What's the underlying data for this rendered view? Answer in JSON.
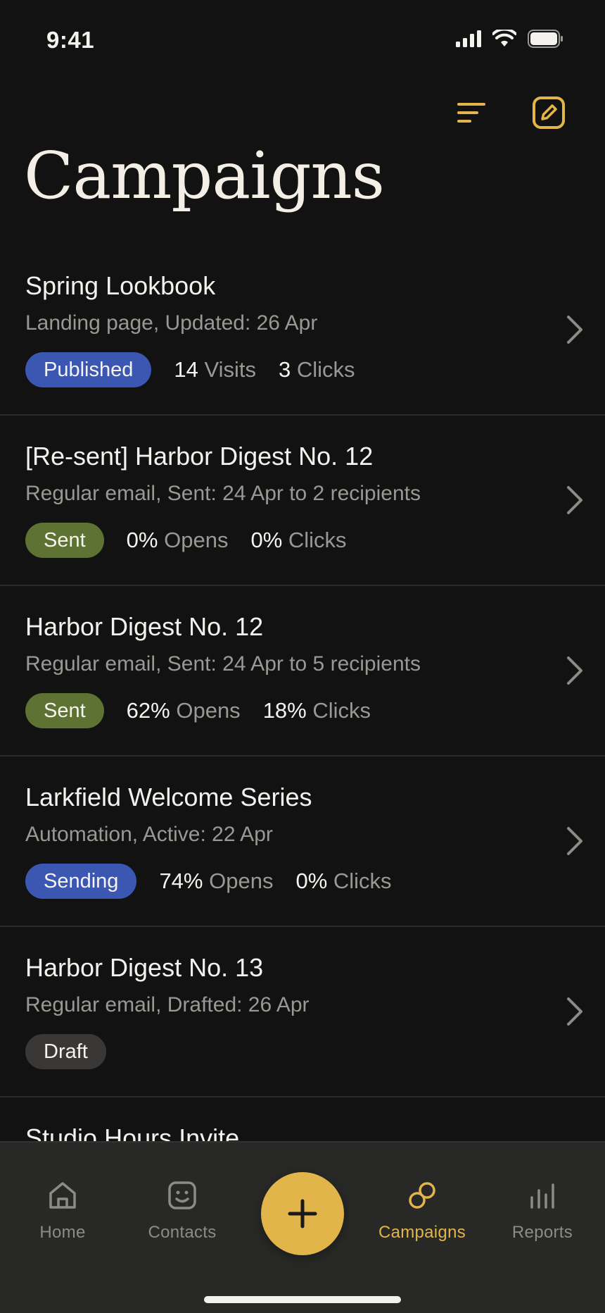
{
  "status": {
    "time": "9:41"
  },
  "header": {
    "title": "Campaigns",
    "sort_icon": "sort-lines-icon",
    "compose_icon": "compose-icon"
  },
  "campaigns": [
    {
      "title": "Spring Lookbook",
      "subtitle": "Landing page, Updated: 26 Apr",
      "badge": "Published",
      "badge_color": "#3c57b2",
      "stat1_value": "14",
      "stat1_label": "Visits",
      "stat2_value": "3",
      "stat2_label": "Clicks"
    },
    {
      "title": "[Re-sent] Harbor Digest No. 12",
      "subtitle": "Regular email, Sent: 24 Apr to 2 recipients",
      "badge": "Sent",
      "badge_color": "#5e7234",
      "stat1_value": "0%",
      "stat1_label": "Opens",
      "stat2_value": "0%",
      "stat2_label": "Clicks"
    },
    {
      "title": "Harbor Digest No. 12",
      "subtitle": "Regular email, Sent: 24 Apr to 5 recipients",
      "badge": "Sent",
      "badge_color": "#5e7234",
      "stat1_value": "62%",
      "stat1_label": "Opens",
      "stat2_value": "18%",
      "stat2_label": "Clicks"
    },
    {
      "title": "Larkfield Welcome Series",
      "subtitle": "Automation, Active: 22 Apr",
      "badge": "Sending",
      "badge_color": "#3c57b2",
      "stat1_value": "74%",
      "stat1_label": "Opens",
      "stat2_value": "0%",
      "stat2_label": "Clicks"
    },
    {
      "title": "Harbor Digest No. 13",
      "subtitle": "Regular email, Drafted: 26 Apr",
      "badge": "Draft",
      "badge_color": "#3a3836"
    },
    {
      "title": "Studio Hours Invite"
    }
  ],
  "tabs": [
    {
      "label": "Home",
      "icon": "home-icon",
      "active": false
    },
    {
      "label": "Contacts",
      "icon": "contacts-icon",
      "active": false
    },
    {
      "label": "Campaigns",
      "icon": "campaigns-icon",
      "active": true
    },
    {
      "label": "Reports",
      "icon": "reports-icon",
      "active": false
    }
  ],
  "fab": {
    "icon": "plus-icon"
  },
  "colors": {
    "accent": "#e2b54a",
    "background": "#121212",
    "tab_bar": "#282827"
  }
}
